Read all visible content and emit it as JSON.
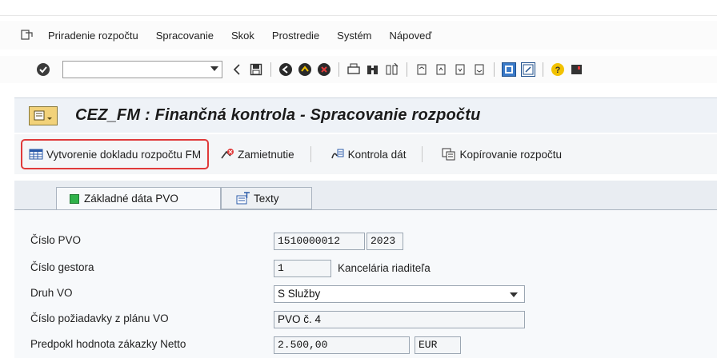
{
  "menu": {
    "items": [
      "Priradenie rozpočtu",
      "Spracovanie",
      "Skok",
      "Prostredie",
      "Systém",
      "Nápoveď"
    ]
  },
  "toolbar": {
    "command_value": "",
    "icons": [
      "enter-icon",
      "back-icon",
      "save-icon",
      "back-green-icon",
      "exit-icon",
      "cancel-icon",
      "print-icon",
      "find-icon",
      "find-next-icon",
      "first-page-icon",
      "previous-page-icon",
      "next-page-icon",
      "last-page-icon",
      "create-session-icon",
      "shortcut-icon",
      "help-icon",
      "layout-menu-icon"
    ]
  },
  "title": "CEZ_FM : Finančná kontrola - Spracovanie rozpočtu",
  "app_toolbar": {
    "create_doc": "Vytvorenie dokladu rozpočtu FM",
    "reject": "Zamietnutie",
    "check_data": "Kontrola dát",
    "copy_budget": "Kopírovanie rozpočtu"
  },
  "tabs": {
    "basic": "Základné dáta PVO",
    "texts": "Texty"
  },
  "form": {
    "pvo_label": "Číslo PVO",
    "pvo_number": "1510000012",
    "pvo_year": "2023",
    "gestor_label": "Číslo gestora",
    "gestor_number": "1",
    "gestor_name": "Kancelária riaditeľa",
    "druh_label": "Druh VO",
    "druh_value": "S Služby",
    "request_label": "Číslo požiadavky z plánu VO",
    "request_value": "PVO č. 4",
    "value_label": "Predpokl hodnota zákazky Netto",
    "value_amount": "2.500,00",
    "currency": "EUR"
  },
  "colors": {
    "highlight_border": "#e03a3a",
    "status_led": "#2fb24a"
  }
}
